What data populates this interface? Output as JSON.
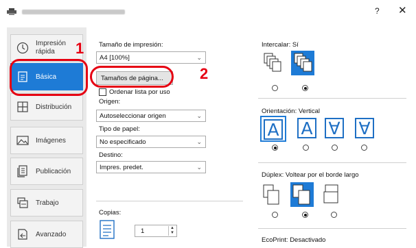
{
  "window": {
    "title_hidden": true,
    "help_label": "?",
    "close_label": "✕"
  },
  "sidebar": {
    "tabs": [
      {
        "label": "Impresión\nrápida",
        "icon": "clock-icon"
      },
      {
        "label": "Básica",
        "icon": "document-icon",
        "active": true
      },
      {
        "label": "Distribución",
        "icon": "grid-icon"
      },
      {
        "label": "Imágenes",
        "icon": "image-icon"
      },
      {
        "label": "Publicación",
        "icon": "publication-icon"
      },
      {
        "label": "Trabajo",
        "icon": "job-icon"
      },
      {
        "label": "Avanzado",
        "icon": "advanced-icon"
      }
    ]
  },
  "callouts": {
    "one": "1",
    "two": "2"
  },
  "basic": {
    "print_size_label": "Tamaño de impresión:",
    "print_size_value": "A4 [100%]",
    "page_sizes_button": "Tamaños de página...",
    "sort_list_label": "Ordenar lista por uso",
    "source_label": "Origen:",
    "source_value": "Autoseleccionar origen",
    "paper_type_label": "Tipo de papel:",
    "paper_type_value": "No especificado",
    "destination_label": "Destino:",
    "destination_value": "Impres. predet.",
    "copies_label": "Copias:",
    "copies_value": "1"
  },
  "right": {
    "collate_label": "Intercalar:",
    "collate_value": "Sí",
    "orientation_label": "Orientación:",
    "orientation_value": "Vertical",
    "orientation_glyphs": [
      "A",
      "A",
      "∀",
      "∀"
    ],
    "duplex_label": "Dúplex:",
    "duplex_value": "Voltear por el borde largo",
    "ecoprint_label": "EcoPrint:",
    "ecoprint_value": "Desactivado",
    "collate_selected": 1,
    "orientation_selected": 0,
    "duplex_selected": 1
  },
  "colors": {
    "accent": "#1e7bd6",
    "callout": "#e60012"
  }
}
